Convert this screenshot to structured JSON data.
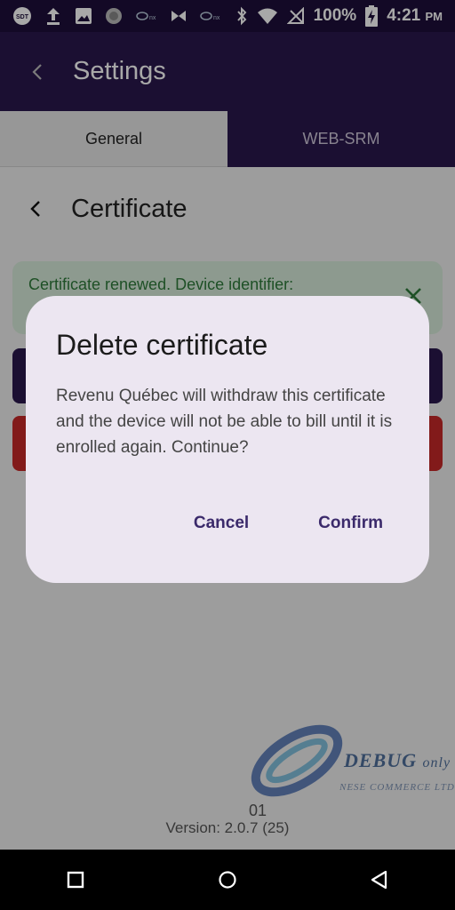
{
  "status_bar": {
    "battery": "100%",
    "time": "4:21",
    "ampm": "PM",
    "left_icons": [
      "sdt-icon",
      "upload-icon",
      "image-icon",
      "circle-icon",
      "link-icon",
      "bow-icon",
      "link-icon"
    ],
    "right_icons": [
      "bluetooth-icon",
      "wifi-icon",
      "no-signal-icon",
      "battery-charging-icon"
    ]
  },
  "app_bar": {
    "title": "Settings"
  },
  "tabs": [
    {
      "label": "General",
      "active": true
    },
    {
      "label": "WEB-SRM",
      "active": false
    }
  ],
  "certificate": {
    "title": "Certificate",
    "notice_text": "Certificate renewed. Device identifier:"
  },
  "dialog": {
    "title": "Delete certificate",
    "message": "Revenu Québec will withdraw this certificate and the device will not be able to bill until it is enrolled again. Continue?",
    "cancel_label": "Cancel",
    "confirm_label": "Confirm"
  },
  "footer": {
    "number": "01",
    "version": "Version: 2.0.7 (25)"
  },
  "watermark": {
    "debug": "DEBUG",
    "only": "only",
    "company": "NESE COMMERCE LTD"
  },
  "colors": {
    "primary": "#2a174d",
    "danger": "#c62828",
    "notice_bg": "#d6ead9",
    "notice_text": "#2e7a3a",
    "dialog_bg": "#ece6f1",
    "dialog_action": "#3b2a6b"
  }
}
